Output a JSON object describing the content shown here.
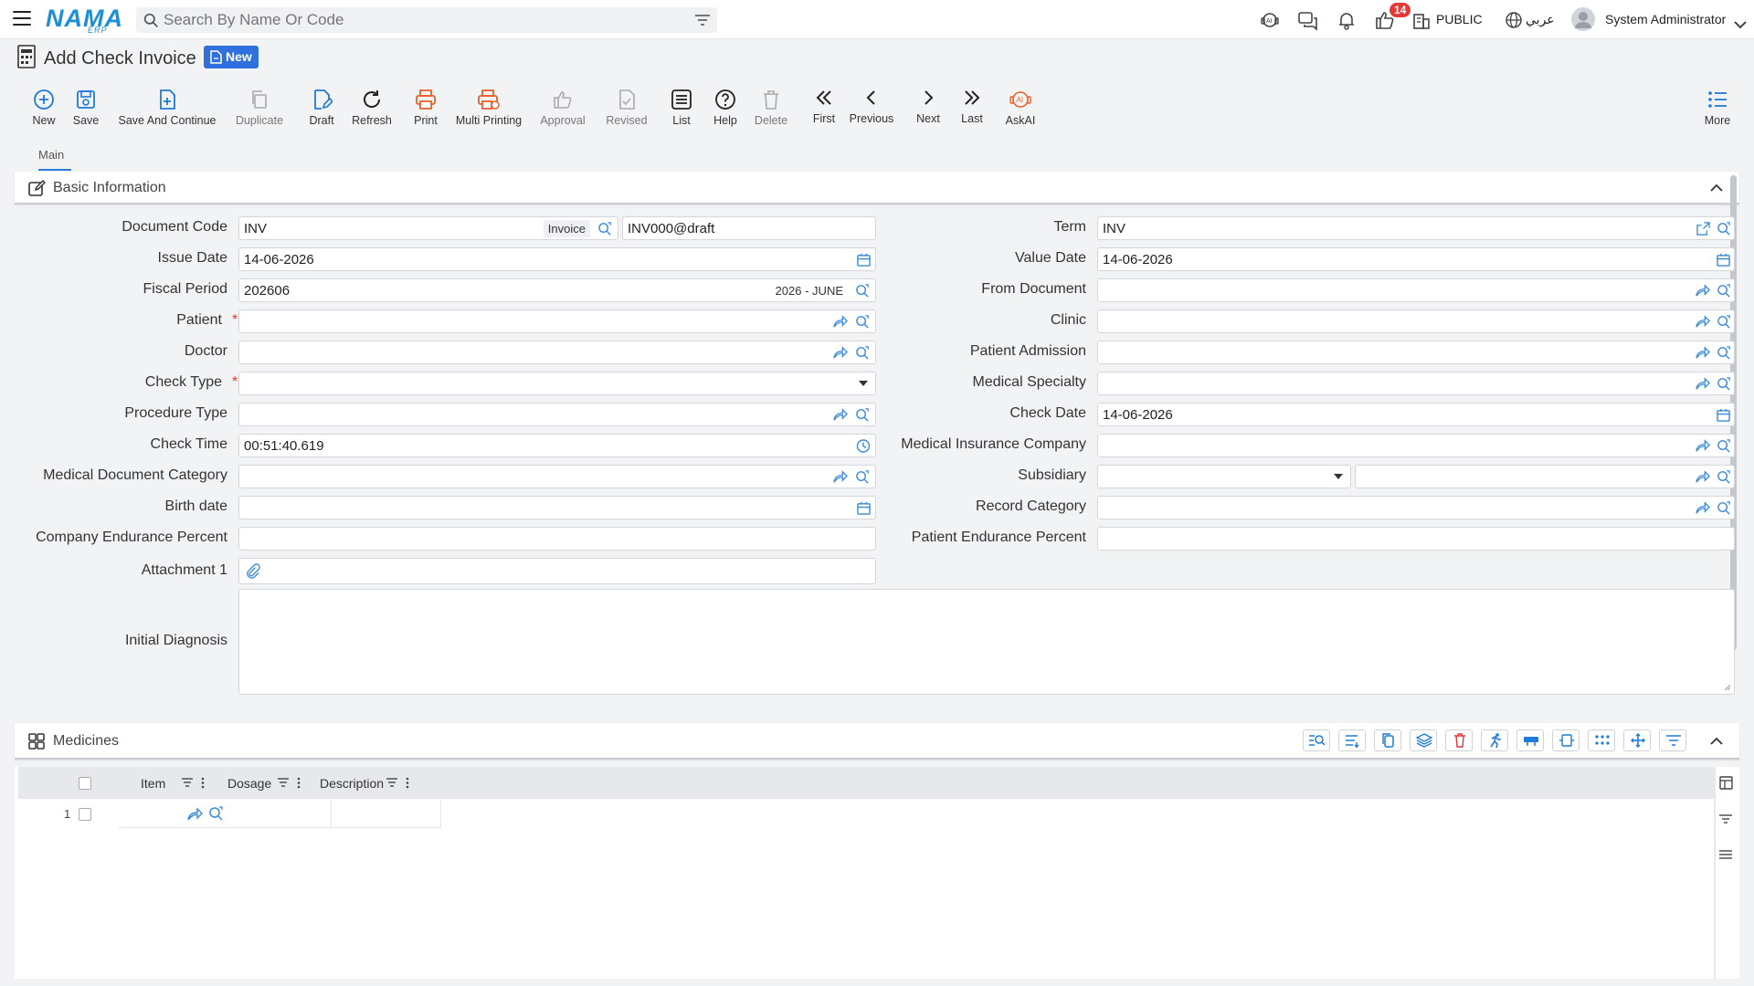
{
  "topbar": {
    "logo": "NAMA",
    "logo_sub": "ERP",
    "search_placeholder": "Search By Name Or Code",
    "notif_count": "14",
    "public_label": "PUBLIC",
    "lang_label": "عربي",
    "user_name": "System Administrator"
  },
  "page": {
    "title": "Add Check Invoice",
    "badge": "New"
  },
  "toolbar": {
    "new": "New",
    "save": "Save",
    "save_continue": "Save And Continue",
    "duplicate": "Duplicate",
    "draft": "Draft",
    "refresh": "Refresh",
    "print": "Print",
    "multi_printing": "Multi Printing",
    "approval": "Approval",
    "revised": "Revised",
    "list": "List",
    "help": "Help",
    "delete": "Delete",
    "first": "First",
    "previous": "Previous",
    "next": "Next",
    "last": "Last",
    "askai": "AskAI",
    "more": "More"
  },
  "tabs": {
    "main": "Main"
  },
  "basic_info": {
    "title": "Basic Information",
    "labels": {
      "document_code": "Document Code",
      "issue_date": "Issue Date",
      "fiscal_period": "Fiscal Period",
      "patient": "Patient",
      "doctor": "Doctor",
      "check_type": "Check Type",
      "procedure_type": "Procedure Type",
      "check_time": "Check Time",
      "medical_document_category": "Medical Document Category",
      "birth_date": "Birth date",
      "company_endurance_percent": "Company Endurance Percent",
      "attachment_1": "Attachment 1",
      "initial_diagnosis": "Initial Diagnosis",
      "term": "Term",
      "value_date": "Value Date",
      "from_document": "From Document",
      "clinic": "Clinic",
      "patient_admission": "Patient Admission",
      "medical_specialty": "Medical Specialty",
      "check_date": "Check Date",
      "medical_insurance_company": "Medical Insurance Company",
      "subsidiary": "Subsidiary",
      "record_category": "Record Category",
      "patient_endurance_percent": "Patient Endurance Percent"
    },
    "values": {
      "document_code": "INV",
      "document_code_tag": "Invoice",
      "document_number": "INV000@draft",
      "issue_date": "14-06-2026",
      "fiscal_period": "202606",
      "fiscal_period_tag": "2026 - JUNE",
      "check_time": "00:51:40.619",
      "term": "INV",
      "value_date": "14-06-2026",
      "check_date": "14-06-2026"
    },
    "required_mark": "*"
  },
  "medicines": {
    "title": "Medicines",
    "columns": [
      "Item",
      "Dosage",
      "Description"
    ],
    "rows": [
      {
        "num": "1"
      }
    ]
  }
}
